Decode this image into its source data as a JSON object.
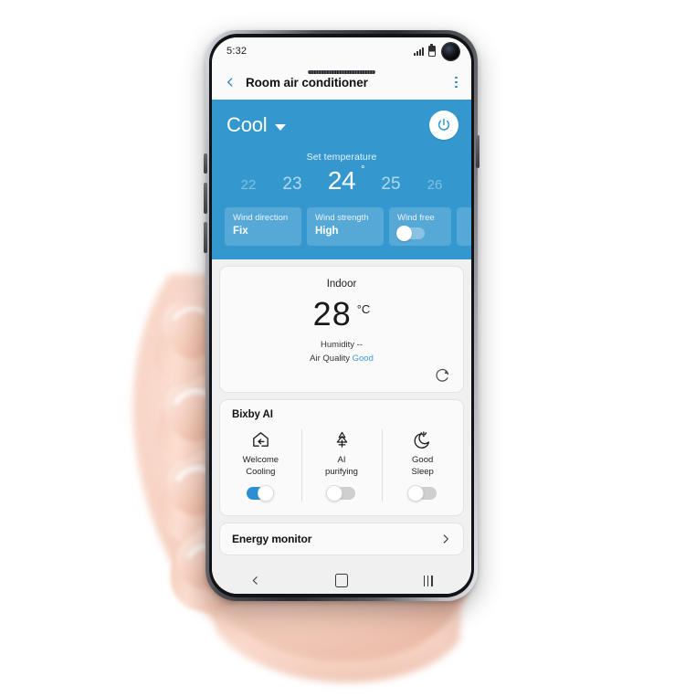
{
  "statusbar": {
    "clock": "5:32",
    "signal_icon": "signal-bars-icon",
    "battery_icon": "battery-icon",
    "camera_icon": "front-camera-punchhole"
  },
  "appbar": {
    "back_icon": "back-chevron-icon",
    "title": "Room air conditioner",
    "more_icon": "more-options-icon"
  },
  "control_panel": {
    "mode": "Cool",
    "mode_caret_icon": "chevron-down-icon",
    "power_icon": "power-icon",
    "set_temperature_label": "Set temperature",
    "temperatures": [
      "22",
      "23",
      "24",
      "25",
      "26"
    ],
    "selected_temperature": "24",
    "degree_symbol": "°",
    "chips": [
      {
        "label": "Wind direction",
        "value": "Fix",
        "type": "value"
      },
      {
        "label": "Wind strength",
        "value": "High",
        "type": "value"
      },
      {
        "label": "Wind free",
        "value": "",
        "type": "toggle",
        "state": "off"
      },
      {
        "label": "",
        "value": "",
        "type": "partial"
      }
    ]
  },
  "indoor_card": {
    "title": "Indoor",
    "temperature": "28",
    "unit": "°C",
    "humidity": "Humidity --",
    "air_quality_label": "Air Quality",
    "air_quality_value": "Good",
    "refresh_icon": "refresh-icon"
  },
  "bixby_card": {
    "title": "Bixby AI",
    "items": [
      {
        "icon": "home-arrow-icon",
        "label_line1": "Welcome",
        "label_line2": "Cooling",
        "toggle": "on"
      },
      {
        "icon": "air-purify-tree-icon",
        "label_line1": "AI",
        "label_line2": "purifying",
        "toggle": "off"
      },
      {
        "icon": "moon-stars-icon",
        "label_line1": "Good",
        "label_line2": "Sleep",
        "toggle": "off"
      }
    ]
  },
  "energy_card": {
    "label": "Energy monitor",
    "chevron_icon": "chevron-right-icon"
  },
  "navbar": {
    "back_icon": "nav-back-icon",
    "home_icon": "nav-home-icon",
    "recents_icon": "nav-recents-icon"
  },
  "colors": {
    "accent_blue": "#3498cf",
    "toggle_on": "#2b8fd6",
    "air_quality_good": "#3d9be0",
    "card_bg": "#fafafa",
    "page_bg": "#f0f0f0"
  }
}
